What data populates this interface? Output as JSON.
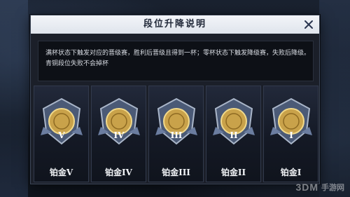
{
  "dialog": {
    "title": "段位升降说明",
    "description_lines": [
      "满杯状态下触发对应的晋级赛，胜利后晋级且得到一杯；零杯状态下触发降级赛，失败后降级。",
      "青铜段位失败不会掉杯"
    ]
  },
  "ranks": [
    {
      "numeral": "V",
      "label": "铂金V"
    },
    {
      "numeral": "IV",
      "label": "铂金IV"
    },
    {
      "numeral": "III",
      "label": "铂金III"
    },
    {
      "numeral": "II",
      "label": "铂金II"
    },
    {
      "numeral": "I",
      "label": "铂金I"
    }
  ],
  "watermark": {
    "logo": "3DM",
    "text": "手游网"
  },
  "colors": {
    "titlebar": "#eef1f6",
    "panel": "#1b1f29",
    "badge_gold": "#c9a24a",
    "badge_silver": "#a9b4c6"
  },
  "icons": {
    "close": "close-icon",
    "badge": "platinum-rank-badge-icon"
  }
}
